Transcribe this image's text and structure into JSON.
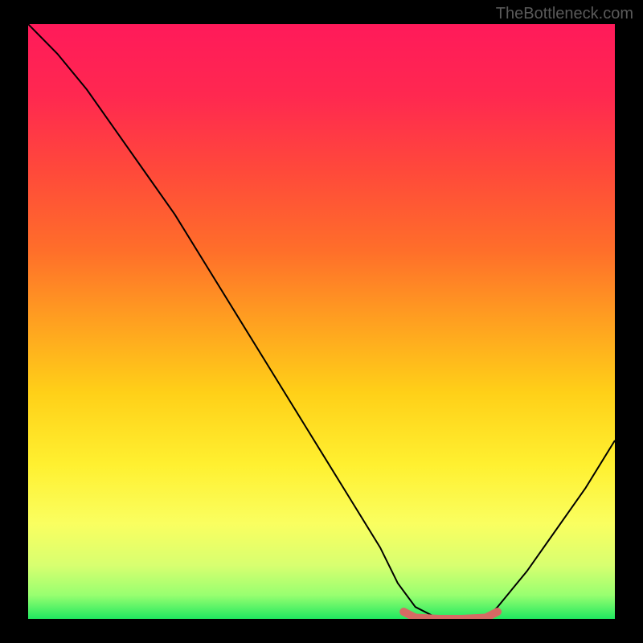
{
  "watermark": "TheBottleneck.com",
  "chart_data": {
    "type": "line",
    "title": "",
    "xlabel": "",
    "ylabel": "",
    "xlim": [
      0,
      100
    ],
    "ylim": [
      0,
      100
    ],
    "series": [
      {
        "name": "bottleneck-curve",
        "x": [
          0,
          5,
          10,
          15,
          20,
          25,
          30,
          35,
          40,
          45,
          50,
          55,
          60,
          63,
          66,
          70,
          74,
          78,
          80,
          85,
          90,
          95,
          100
        ],
        "values": [
          100,
          95,
          89,
          82,
          75,
          68,
          60,
          52,
          44,
          36,
          28,
          20,
          12,
          6,
          2,
          0,
          0,
          0,
          2,
          8,
          15,
          22,
          30
        ]
      },
      {
        "name": "optimal-marker",
        "x": [
          64,
          66,
          70,
          74,
          78,
          80
        ],
        "values": [
          1.2,
          0.2,
          0,
          0,
          0.2,
          1.2
        ]
      }
    ],
    "gradient_stops": [
      {
        "pos": 0.0,
        "color": "#ff1a5a"
      },
      {
        "pos": 0.12,
        "color": "#ff2850"
      },
      {
        "pos": 0.25,
        "color": "#ff4a3a"
      },
      {
        "pos": 0.38,
        "color": "#ff6e2a"
      },
      {
        "pos": 0.5,
        "color": "#ffa020"
      },
      {
        "pos": 0.62,
        "color": "#ffd018"
      },
      {
        "pos": 0.74,
        "color": "#fff030"
      },
      {
        "pos": 0.84,
        "color": "#faff60"
      },
      {
        "pos": 0.91,
        "color": "#d8ff70"
      },
      {
        "pos": 0.96,
        "color": "#98ff70"
      },
      {
        "pos": 1.0,
        "color": "#20e860"
      }
    ],
    "colors": {
      "curve": "#000000",
      "marker": "#d66a64"
    }
  }
}
